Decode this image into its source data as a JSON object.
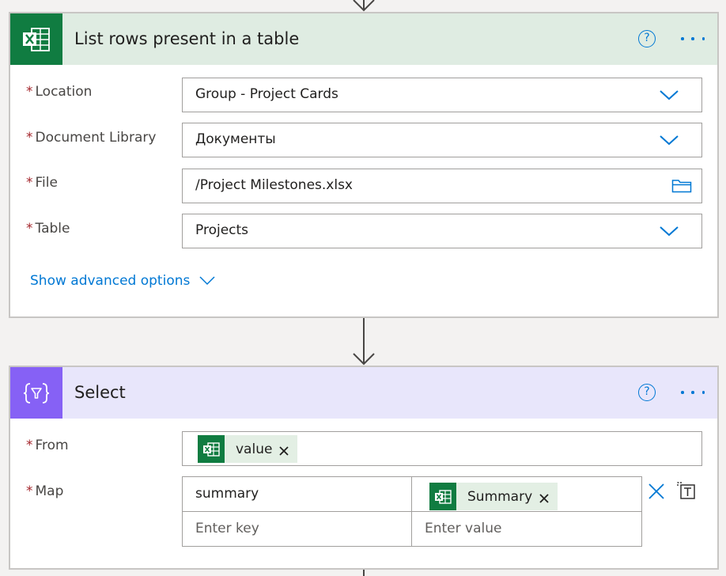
{
  "card1": {
    "title": "List rows present in a table",
    "help_glyph": "?",
    "header_color": "#dfece2",
    "icon_color": "#107c41",
    "icon_name": "excel-icon",
    "fields": {
      "location": {
        "label": "Location",
        "value": "Group - Project Cards"
      },
      "document_library": {
        "label": "Document Library",
        "value": "Документы"
      },
      "file": {
        "label": "File",
        "value": "/Project Milestones.xlsx"
      },
      "table": {
        "label": "Table",
        "value": "Projects"
      }
    },
    "required_mark": "*",
    "advanced_label": "Show advanced options"
  },
  "card2": {
    "title": "Select",
    "help_glyph": "?",
    "header_color": "#e8e6fb",
    "icon_color": "#8661f5",
    "icon_name": "data-operation-icon",
    "required_mark": "*",
    "from": {
      "label": "From",
      "token": "value"
    },
    "map": {
      "label": "Map",
      "rows": [
        {
          "key": "summary",
          "value_token": "Summary"
        }
      ],
      "key_placeholder": "Enter key",
      "value_placeholder": "Enter value"
    }
  },
  "colors": {
    "accent": "#0078d4",
    "required": "#a4262c",
    "excel_green": "#107c41",
    "token_bg": "#e3efe4"
  }
}
